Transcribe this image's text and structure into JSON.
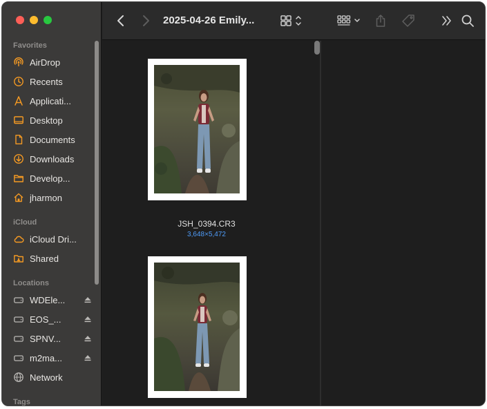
{
  "toolbar": {
    "title": "2025-04-26 Emily...",
    "back_icon": "chevron-left-icon",
    "forward_icon": "chevron-right-icon",
    "view_icon": "grid-view-icon",
    "group_icon": "group-by-icon",
    "share_icon": "share-icon",
    "tag_icon": "tag-icon",
    "more_icon": "double-chevron-icon",
    "search_icon": "search-icon"
  },
  "sidebar": {
    "favorites_heading": "Favorites",
    "favorites": [
      {
        "label": "AirDrop",
        "icon": "airdrop-icon"
      },
      {
        "label": "Recents",
        "icon": "clock-icon"
      },
      {
        "label": "Applicati...",
        "icon": "applications-icon"
      },
      {
        "label": "Desktop",
        "icon": "desktop-icon"
      },
      {
        "label": "Documents",
        "icon": "document-icon"
      },
      {
        "label": "Downloads",
        "icon": "download-icon"
      },
      {
        "label": "Develop...",
        "icon": "folder-icon"
      },
      {
        "label": "jharmon",
        "icon": "home-icon"
      }
    ],
    "icloud_heading": "iCloud",
    "icloud": [
      {
        "label": "iCloud Dri...",
        "icon": "cloud-icon"
      },
      {
        "label": "Shared",
        "icon": "shared-folder-icon"
      }
    ],
    "locations_heading": "Locations",
    "locations": [
      {
        "label": "WDEle...",
        "icon": "drive-icon"
      },
      {
        "label": "EOS_...",
        "icon": "drive-icon"
      },
      {
        "label": "SPNV...",
        "icon": "drive-icon"
      },
      {
        "label": "m2ma...",
        "icon": "drive-icon"
      },
      {
        "label": "Network",
        "icon": "network-icon"
      }
    ],
    "tags_heading": "Tags"
  },
  "files": [
    {
      "name": "JSH_0394.CR3",
      "dimensions": "3,648×5,472"
    },
    {
      "name": "",
      "dimensions": ""
    }
  ],
  "colors": {
    "accent": "#f59a23",
    "link_blue": "#4f9cf9",
    "sidebar_bg": "#3b3a39",
    "content_bg": "#1e1e1e"
  }
}
